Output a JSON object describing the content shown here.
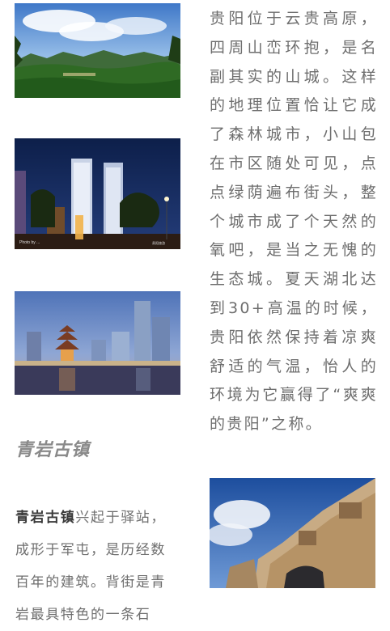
{
  "intro_paragraph": "贵阳位于云贵高原，四周山峦环抱，是名副其实的山城。这样的地理位置恰让它成了森林城市，小山包在市区随处可见，点点绿荫遍布街头，整个城市成了个天然的氧吧，是当之无愧的生态城。夏天湖北达到30+高温的时候，贵阳依然保持着凉爽舒适的气温，怡人的环境为它赢得了“爽爽的贵阳”之称。",
  "section": {
    "heading": "青岩古镇",
    "bold_lead": "青岩古镇",
    "text": "兴起于驿站，成形于军屯，是历经数百年的建筑。背街是青岩最具特色的一条石"
  },
  "photos": {
    "night_caption_left": "Photo by ...",
    "night_caption_right": "贵阳旅游"
  },
  "colors": {
    "text": "#6e6e6e",
    "heading": "#8a8a8a",
    "bold": "#3a3a3a"
  }
}
